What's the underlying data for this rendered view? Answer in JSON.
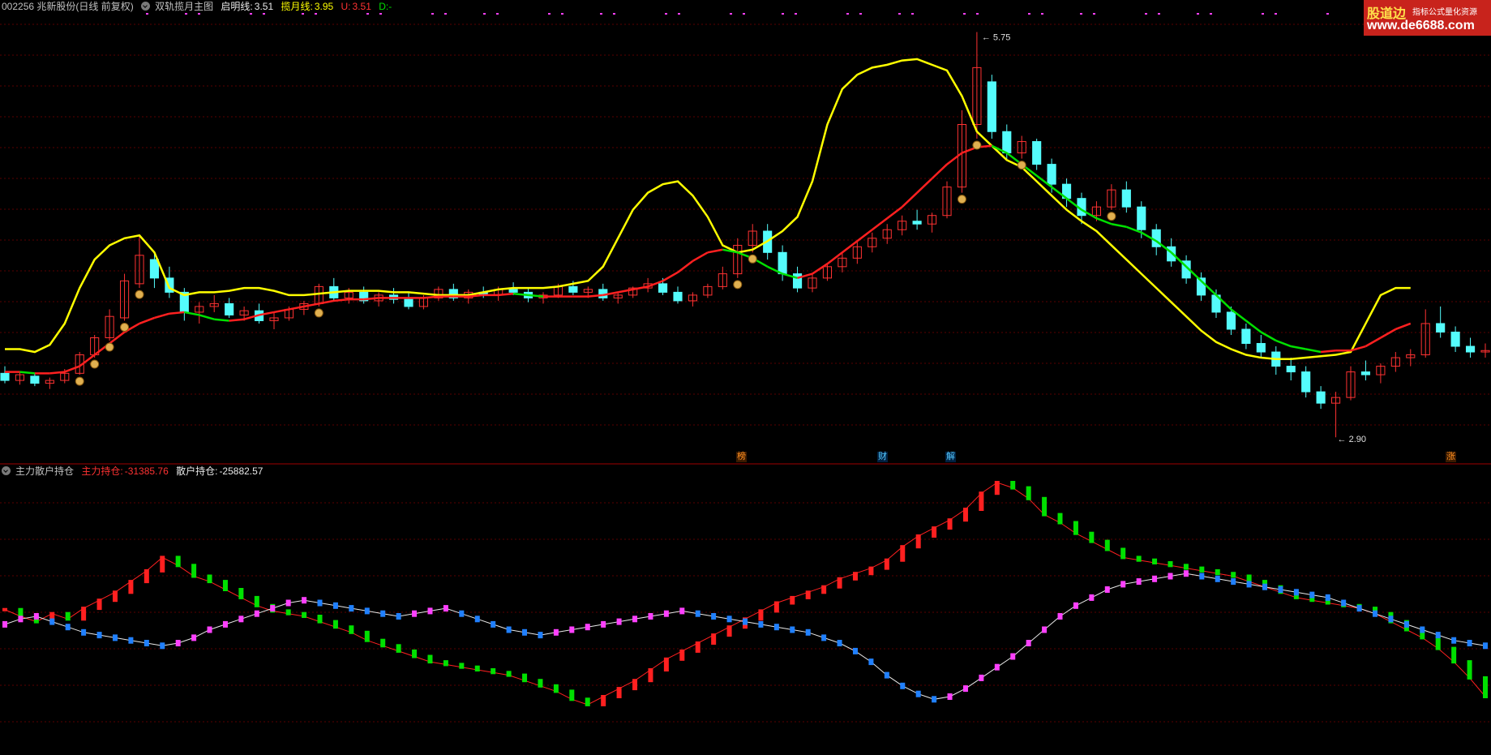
{
  "main_header": {
    "stock": "002256 兆新股份(日线 前复权)",
    "indicator_name": "双轨揽月主图",
    "qm_label": "启明线:",
    "qm_value": "3.51",
    "ly_label": "揽月线:",
    "ly_value": "3.95",
    "u_label": "U:",
    "u_value": "3.51",
    "d_label": "D:",
    "d_value": "-"
  },
  "sub_header": {
    "indicator_name": "主力散户持仓",
    "zl_label": "主力持仓:",
    "zl_value": "-31385.76",
    "sh_label": "散户持仓:",
    "sh_value": "-25882.57"
  },
  "price_annotations": {
    "high": "5.75",
    "low": "2.90"
  },
  "markers": [
    "榜",
    "财",
    "解",
    "涨"
  ],
  "watermark": {
    "brand": "股道边",
    "tagline": "指标公式量化资源",
    "url": "www.de6688.com"
  },
  "colors": {
    "up": "#ff3232",
    "down": "#54fcfc",
    "yellow_line": "#ffff00",
    "mid_red": "#ff2020",
    "mid_green": "#00e000",
    "grid": "#5a0000",
    "magenta": "#ff40ff",
    "blue": "#2080ff",
    "green_bar": "#00e000"
  },
  "chart_data": [
    {
      "type": "candlestick",
      "title": "双轨揽月主图",
      "ylim": [
        2.85,
        5.85
      ],
      "candles": [
        [
          3.35,
          3.4,
          3.28,
          3.3
        ],
        [
          3.3,
          3.36,
          3.27,
          3.34
        ],
        [
          3.33,
          3.35,
          3.26,
          3.28
        ],
        [
          3.28,
          3.32,
          3.24,
          3.3
        ],
        [
          3.3,
          3.38,
          3.28,
          3.35
        ],
        [
          3.35,
          3.5,
          3.34,
          3.48
        ],
        [
          3.48,
          3.62,
          3.46,
          3.6
        ],
        [
          3.6,
          3.8,
          3.58,
          3.75
        ],
        [
          3.74,
          4.05,
          3.72,
          4.0
        ],
        [
          3.98,
          4.32,
          3.95,
          4.18
        ],
        [
          4.15,
          4.2,
          3.95,
          4.02
        ],
        [
          4.02,
          4.1,
          3.88,
          3.92
        ],
        [
          3.92,
          3.95,
          3.72,
          3.78
        ],
        [
          3.78,
          3.85,
          3.7,
          3.82
        ],
        [
          3.82,
          3.9,
          3.78,
          3.84
        ],
        [
          3.84,
          3.88,
          3.74,
          3.76
        ],
        [
          3.76,
          3.82,
          3.72,
          3.79
        ],
        [
          3.79,
          3.84,
          3.7,
          3.72
        ],
        [
          3.72,
          3.78,
          3.66,
          3.74
        ],
        [
          3.74,
          3.82,
          3.72,
          3.8
        ],
        [
          3.8,
          3.86,
          3.76,
          3.84
        ],
        [
          3.84,
          3.98,
          3.82,
          3.96
        ],
        [
          3.96,
          4.02,
          3.86,
          3.88
        ],
        [
          3.88,
          3.95,
          3.84,
          3.92
        ],
        [
          3.92,
          3.96,
          3.84,
          3.86
        ],
        [
          3.86,
          3.92,
          3.82,
          3.9
        ],
        [
          3.9,
          3.95,
          3.84,
          3.87
        ],
        [
          3.87,
          3.92,
          3.8,
          3.82
        ],
        [
          3.82,
          3.9,
          3.8,
          3.88
        ],
        [
          3.88,
          3.96,
          3.86,
          3.94
        ],
        [
          3.94,
          3.98,
          3.86,
          3.88
        ],
        [
          3.88,
          3.94,
          3.84,
          3.92
        ],
        [
          3.92,
          3.96,
          3.88,
          3.9
        ],
        [
          3.9,
          3.96,
          3.86,
          3.94
        ],
        [
          3.94,
          3.99,
          3.9,
          3.92
        ],
        [
          3.92,
          3.95,
          3.85,
          3.88
        ],
        [
          3.88,
          3.92,
          3.84,
          3.9
        ],
        [
          3.9,
          3.98,
          3.88,
          3.96
        ],
        [
          3.96,
          4.0,
          3.9,
          3.92
        ],
        [
          3.92,
          3.96,
          3.88,
          3.94
        ],
        [
          3.94,
          3.98,
          3.86,
          3.88
        ],
        [
          3.88,
          3.92,
          3.84,
          3.9
        ],
        [
          3.9,
          3.96,
          3.88,
          3.95
        ],
        [
          3.95,
          4.02,
          3.92,
          3.98
        ],
        [
          3.98,
          4.02,
          3.9,
          3.92
        ],
        [
          3.92,
          3.96,
          3.84,
          3.86
        ],
        [
          3.86,
          3.92,
          3.82,
          3.9
        ],
        [
          3.9,
          3.98,
          3.88,
          3.96
        ],
        [
          3.96,
          4.1,
          3.94,
          4.05
        ],
        [
          4.05,
          4.3,
          4.02,
          4.25
        ],
        [
          4.25,
          4.4,
          4.2,
          4.35
        ],
        [
          4.35,
          4.4,
          4.15,
          4.2
        ],
        [
          4.2,
          4.25,
          4.0,
          4.05
        ],
        [
          4.05,
          4.1,
          3.92,
          3.95
        ],
        [
          3.95,
          4.05,
          3.92,
          4.02
        ],
        [
          4.02,
          4.12,
          4.0,
          4.1
        ],
        [
          4.1,
          4.2,
          4.06,
          4.16
        ],
        [
          4.16,
          4.28,
          4.12,
          4.24
        ],
        [
          4.24,
          4.34,
          4.2,
          4.3
        ],
        [
          4.3,
          4.4,
          4.26,
          4.36
        ],
        [
          4.36,
          4.46,
          4.32,
          4.42
        ],
        [
          4.42,
          4.5,
          4.36,
          4.4
        ],
        [
          4.4,
          4.48,
          4.34,
          4.46
        ],
        [
          4.46,
          4.7,
          4.44,
          4.66
        ],
        [
          4.66,
          5.2,
          4.62,
          5.1
        ],
        [
          5.1,
          5.75,
          5.0,
          5.5
        ],
        [
          5.4,
          5.45,
          5.0,
          5.05
        ],
        [
          5.05,
          5.1,
          4.85,
          4.9
        ],
        [
          4.9,
          5.02,
          4.86,
          4.98
        ],
        [
          4.98,
          5.0,
          4.78,
          4.82
        ],
        [
          4.82,
          4.86,
          4.62,
          4.68
        ],
        [
          4.68,
          4.72,
          4.52,
          4.58
        ],
        [
          4.58,
          4.62,
          4.4,
          4.46
        ],
        [
          4.46,
          4.56,
          4.42,
          4.52
        ],
        [
          4.52,
          4.68,
          4.5,
          4.64
        ],
        [
          4.64,
          4.7,
          4.48,
          4.52
        ],
        [
          4.52,
          4.56,
          4.3,
          4.36
        ],
        [
          4.36,
          4.4,
          4.18,
          4.24
        ],
        [
          4.24,
          4.3,
          4.1,
          4.14
        ],
        [
          4.14,
          4.18,
          3.98,
          4.02
        ],
        [
          4.02,
          4.06,
          3.86,
          3.9
        ],
        [
          3.9,
          3.94,
          3.74,
          3.78
        ],
        [
          3.78,
          3.82,
          3.62,
          3.66
        ],
        [
          3.66,
          3.7,
          3.52,
          3.56
        ],
        [
          3.56,
          3.62,
          3.46,
          3.5
        ],
        [
          3.5,
          3.54,
          3.34,
          3.4
        ],
        [
          3.4,
          3.46,
          3.3,
          3.36
        ],
        [
          3.36,
          3.4,
          3.18,
          3.22
        ],
        [
          3.22,
          3.26,
          3.1,
          3.14
        ],
        [
          3.14,
          3.22,
          2.9,
          3.18
        ],
        [
          3.18,
          3.4,
          3.16,
          3.36
        ],
        [
          3.36,
          3.44,
          3.3,
          3.34
        ],
        [
          3.34,
          3.42,
          3.28,
          3.4
        ],
        [
          3.4,
          3.5,
          3.36,
          3.46
        ],
        [
          3.46,
          3.52,
          3.4,
          3.48
        ],
        [
          3.48,
          3.8,
          3.46,
          3.7
        ],
        [
          3.7,
          3.82,
          3.6,
          3.64
        ],
        [
          3.64,
          3.68,
          3.5,
          3.54
        ],
        [
          3.54,
          3.6,
          3.46,
          3.5
        ],
        [
          3.5,
          3.56,
          3.46,
          3.51
        ]
      ],
      "upper_line": [
        3.52,
        3.52,
        3.5,
        3.55,
        3.7,
        3.95,
        4.15,
        4.25,
        4.3,
        4.32,
        4.2,
        3.95,
        3.9,
        3.92,
        3.92,
        3.93,
        3.95,
        3.95,
        3.93,
        3.9,
        3.9,
        3.91,
        3.92,
        3.93,
        3.93,
        3.93,
        3.92,
        3.92,
        3.91,
        3.9,
        3.9,
        3.9,
        3.92,
        3.94,
        3.95,
        3.95,
        3.95,
        3.96,
        3.98,
        4.0,
        4.1,
        4.3,
        4.5,
        4.62,
        4.68,
        4.7,
        4.6,
        4.45,
        4.25,
        4.2,
        4.22,
        4.28,
        4.35,
        4.45,
        4.7,
        5.1,
        5.35,
        5.45,
        5.5,
        5.52,
        5.55,
        5.56,
        5.52,
        5.48,
        5.3,
        5.05,
        4.95,
        4.85,
        4.8,
        4.7,
        4.6,
        4.5,
        4.42,
        4.35,
        4.25,
        4.15,
        4.05,
        3.95,
        3.85,
        3.75,
        3.65,
        3.57,
        3.52,
        3.48,
        3.46,
        3.45,
        3.45,
        3.46,
        3.47,
        3.48,
        3.5,
        3.7,
        3.9,
        3.95,
        3.95
      ],
      "mid_line": [
        3.36,
        3.36,
        3.35,
        3.35,
        3.36,
        3.4,
        3.48,
        3.56,
        3.64,
        3.7,
        3.74,
        3.77,
        3.78,
        3.76,
        3.73,
        3.72,
        3.73,
        3.76,
        3.78,
        3.8,
        3.82,
        3.84,
        3.86,
        3.87,
        3.87,
        3.88,
        3.88,
        3.88,
        3.88,
        3.89,
        3.89,
        3.89,
        3.9,
        3.9,
        3.91,
        3.9,
        3.89,
        3.89,
        3.89,
        3.89,
        3.9,
        3.92,
        3.94,
        3.96,
        4.0,
        4.06,
        4.14,
        4.2,
        4.22,
        4.2,
        4.16,
        4.1,
        4.05,
        4.02,
        4.05,
        4.12,
        4.2,
        4.28,
        4.36,
        4.44,
        4.52,
        4.62,
        4.72,
        4.82,
        4.9,
        4.94,
        4.95,
        4.9,
        4.82,
        4.74,
        4.66,
        4.58,
        4.5,
        4.44,
        4.4,
        4.38,
        4.34,
        4.28,
        4.2,
        4.1,
        4.0,
        3.9,
        3.8,
        3.72,
        3.64,
        3.58,
        3.54,
        3.52,
        3.5,
        3.51,
        3.51,
        3.54,
        3.6,
        3.66,
        3.7
      ]
    },
    {
      "type": "line",
      "title": "主力散户持仓",
      "ylim": [
        -100,
        100
      ],
      "series": [
        {
          "name": "主力持仓",
          "values": [
            5,
            0,
            -4,
            2,
            -2,
            6,
            12,
            18,
            26,
            34,
            44,
            38,
            30,
            26,
            20,
            14,
            8,
            4,
            2,
            0,
            -4,
            -8,
            -12,
            -18,
            -22,
            -26,
            -30,
            -34,
            -36,
            -38,
            -40,
            -42,
            -44,
            -48,
            -52,
            -56,
            -62,
            -66,
            -60,
            -54,
            -48,
            -40,
            -32,
            -26,
            -20,
            -14,
            -8,
            -2,
            4,
            10,
            14,
            18,
            22,
            28,
            32,
            36,
            42,
            52,
            60,
            66,
            72,
            80,
            92,
            100,
            96,
            88,
            76,
            70,
            62,
            56,
            50,
            44,
            42,
            40,
            38,
            36,
            34,
            32,
            30,
            26,
            22,
            18,
            14,
            12,
            10,
            8,
            6,
            2,
            -4,
            -10,
            -16,
            -24,
            -34,
            -46,
            -60
          ]
        },
        {
          "name": "散户持仓",
          "values": [
            -6,
            -2,
            0,
            -4,
            -8,
            -12,
            -14,
            -16,
            -18,
            -20,
            -22,
            -20,
            -16,
            -10,
            -6,
            -2,
            2,
            6,
            10,
            12,
            10,
            8,
            6,
            4,
            2,
            0,
            2,
            4,
            6,
            2,
            -2,
            -6,
            -10,
            -12,
            -14,
            -12,
            -10,
            -8,
            -6,
            -4,
            -2,
            0,
            2,
            4,
            2,
            0,
            -2,
            -4,
            -6,
            -8,
            -10,
            -12,
            -16,
            -20,
            -26,
            -34,
            -44,
            -52,
            -58,
            -62,
            -60,
            -54,
            -46,
            -38,
            -30,
            -20,
            -10,
            0,
            8,
            14,
            20,
            24,
            26,
            28,
            30,
            32,
            30,
            28,
            26,
            24,
            22,
            20,
            18,
            16,
            14,
            10,
            6,
            2,
            -2,
            -6,
            -10,
            -14,
            -18,
            -20,
            -22
          ]
        }
      ]
    }
  ]
}
